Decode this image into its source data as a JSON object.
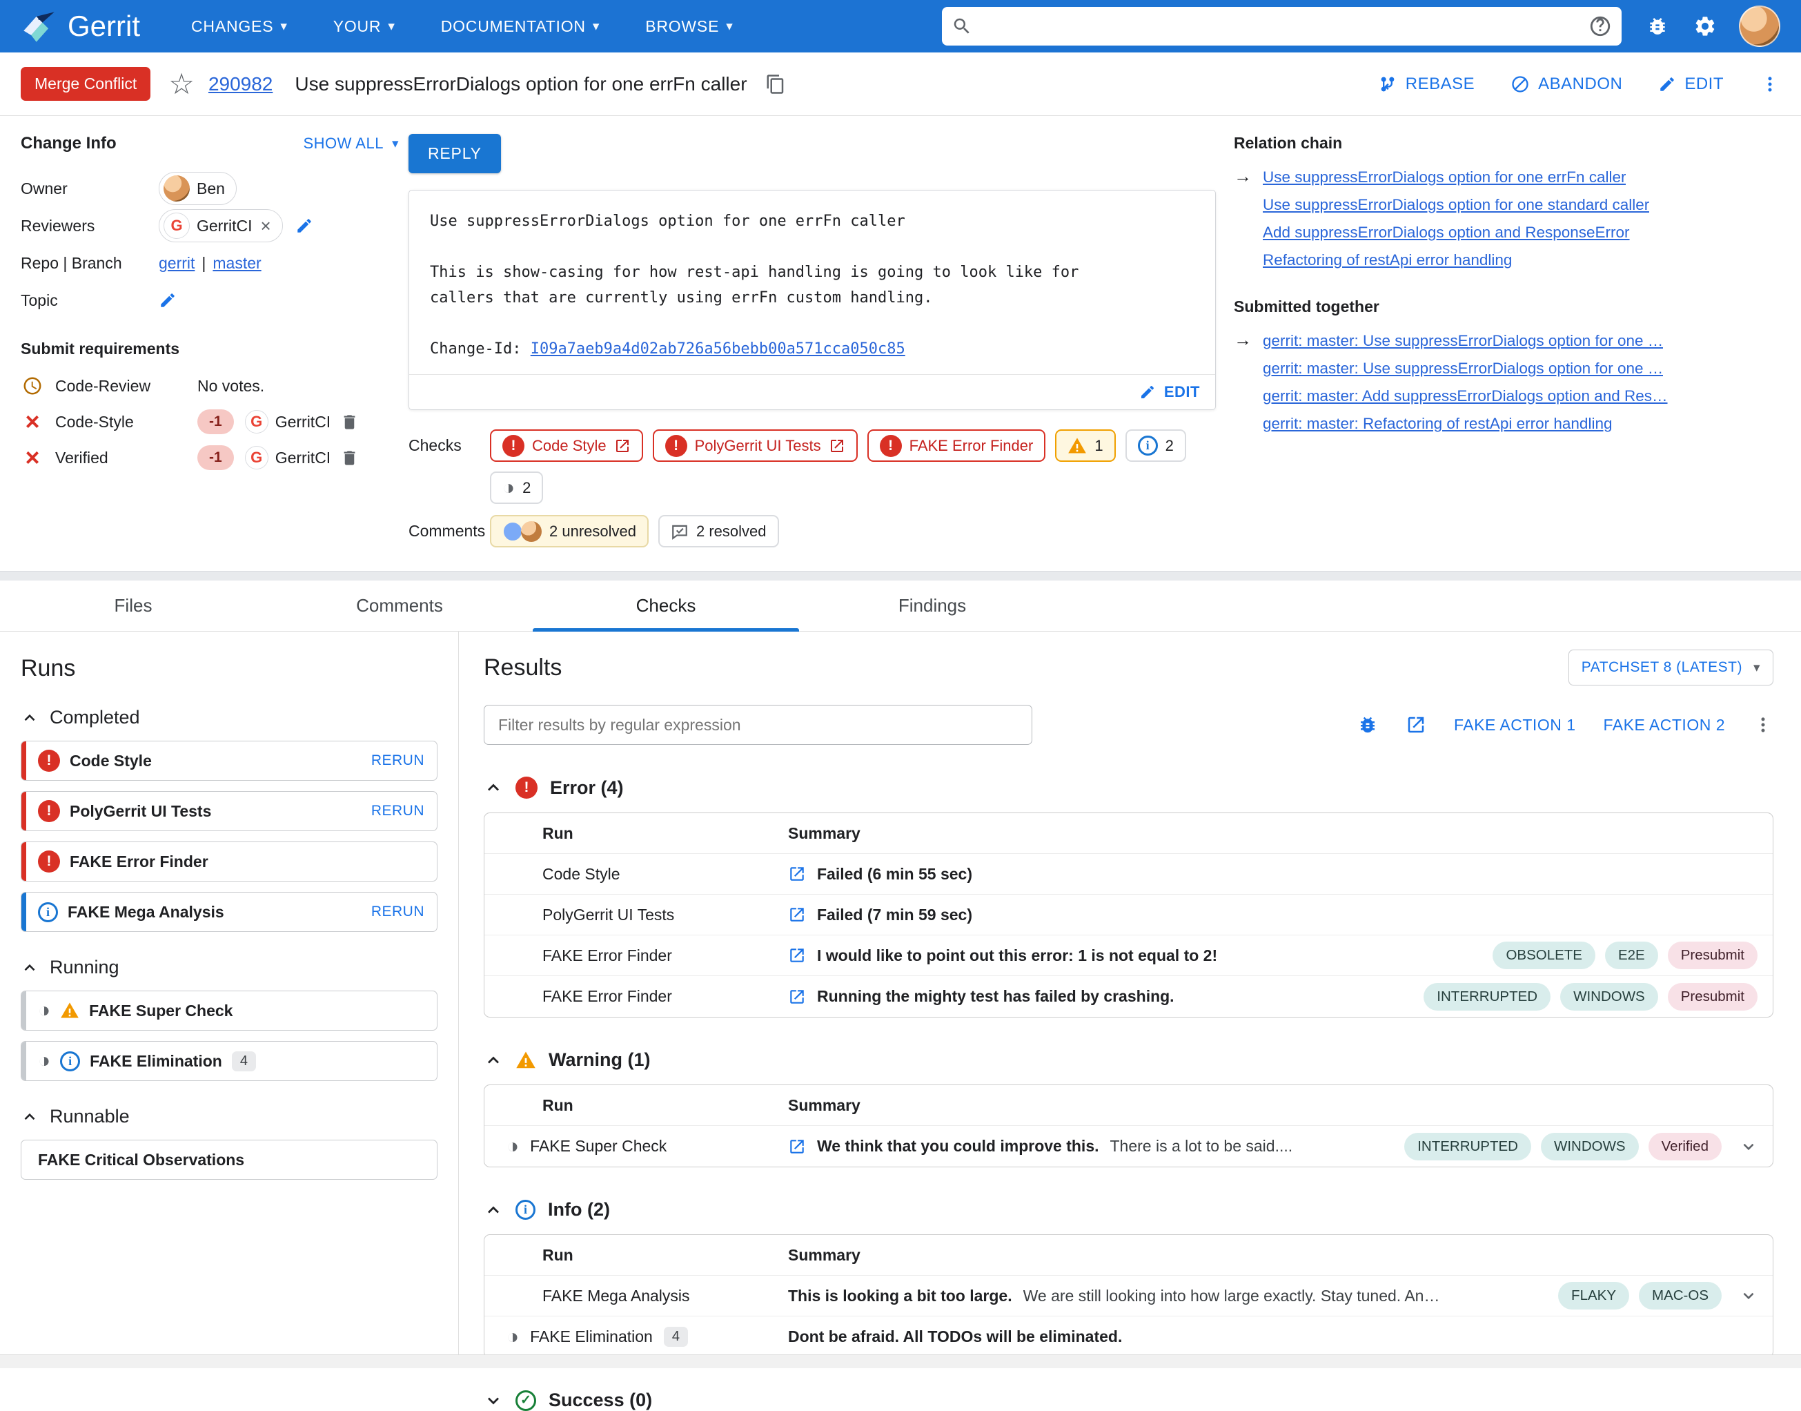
{
  "colors": {
    "topbar_blue": "#1c73d3",
    "accent_blue": "#1976d2",
    "action_blue": "#1a73e8",
    "link_blue": "#2a66d9",
    "error_red": "#d93025",
    "warning_orange": "#f29900",
    "success_green": "#188038"
  },
  "topbar": {
    "brand": "Gerrit",
    "nav": [
      {
        "label": "CHANGES"
      },
      {
        "label": "YOUR"
      },
      {
        "label": "DOCUMENTATION"
      },
      {
        "label": "BROWSE"
      }
    ],
    "search": {
      "value": "",
      "placeholder": ""
    }
  },
  "header": {
    "status": "Merge Conflict",
    "change_number": "290982",
    "title": "Use suppressErrorDialogs option for one errFn caller",
    "rebase": "REBASE",
    "abandon": "ABANDON",
    "edit": "EDIT"
  },
  "change_info": {
    "heading": "Change Info",
    "show_all": "SHOW ALL",
    "owner_label": "Owner",
    "owner_name": "Ben",
    "reviewers_label": "Reviewers",
    "reviewer_name": "GerritCI",
    "reviewer_initial": "G",
    "repo_branch_label": "Repo | Branch",
    "repo": "gerrit",
    "separator": "|",
    "branch": "master",
    "topic_label": "Topic",
    "submit_requirements_heading": "Submit requirements",
    "code_review_label": "Code-Review",
    "code_review_value": "No votes.",
    "code_style_label": "Code-Style",
    "code_style_vote": "-1",
    "code_style_by": "GerritCI",
    "verified_label": "Verified",
    "verified_vote": "-1",
    "verified_by": "GerritCI"
  },
  "reply_button": "REPLY",
  "commit_message": {
    "title_line": "Use suppressErrorDialogs option for one errFn caller",
    "body_line1": "This is show-casing for how rest-api handling is going to look like for",
    "body_line2": "callers that are currently using errFn custom handling.",
    "change_id_label": "Change-Id: ",
    "change_id": "I09a7aeb9a4d02ab726a56bebb00a571cca050c85",
    "edit_link": "EDIT"
  },
  "checks_summary": {
    "label": "Checks",
    "chips": [
      {
        "label": "Code Style",
        "status": "error"
      },
      {
        "label": "PolyGerrit UI Tests",
        "status": "error"
      },
      {
        "label": "FAKE Error Finder",
        "status": "error"
      }
    ],
    "warning_count": "1",
    "info_count": "2",
    "running_count": "2"
  },
  "comments_summary": {
    "label": "Comments",
    "unresolved": "2 unresolved",
    "resolved": "2 resolved"
  },
  "relation_chain": {
    "heading": "Relation chain",
    "items": [
      {
        "label": "Use suppressErrorDialogs option for one errFn caller"
      },
      {
        "label": "Use suppressErrorDialogs option for one standard caller"
      },
      {
        "label": "Add suppressErrorDialogs option and ResponseError"
      },
      {
        "label": "Refactoring of restApi error handling"
      }
    ]
  },
  "submitted_together": {
    "heading": "Submitted together",
    "items": [
      {
        "label": "gerrit: master: Use suppressErrorDialogs option for one …"
      },
      {
        "label": "gerrit: master: Use suppressErrorDialogs option for one …"
      },
      {
        "label": "gerrit: master: Add suppressErrorDialogs option and Res…"
      },
      {
        "label": "gerrit: master: Refactoring of restApi error handling"
      }
    ]
  },
  "tabs": [
    {
      "label": "Files"
    },
    {
      "label": "Comments"
    },
    {
      "label": "Checks",
      "active": true
    },
    {
      "label": "Findings"
    }
  ],
  "runs_panel": {
    "heading": "Runs",
    "sections": [
      {
        "title": "Completed",
        "runs": [
          {
            "label": "Code Style",
            "status": "error",
            "action": "RERUN"
          },
          {
            "label": "PolyGerrit UI Tests",
            "status": "error",
            "action": "RERUN"
          },
          {
            "label": "FAKE Error Finder",
            "status": "error"
          },
          {
            "label": "FAKE Mega Analysis",
            "status": "info",
            "action": "RERUN"
          }
        ]
      },
      {
        "title": "Running",
        "runs": [
          {
            "label": "FAKE Super Check",
            "status": "running-warning"
          },
          {
            "label": "FAKE Elimination",
            "status": "running-info",
            "badge": "4"
          }
        ]
      },
      {
        "title": "Runnable",
        "runs": [
          {
            "label": "FAKE Critical Observations"
          }
        ]
      }
    ]
  },
  "results_panel": {
    "heading": "Results",
    "patchset_button": "PATCHSET 8 (LATEST)",
    "filter_placeholder": "Filter results by regular expression",
    "action1": "FAKE ACTION 1",
    "action2": "FAKE ACTION 2",
    "table_header_run": "Run",
    "table_header_summary": "Summary",
    "sections": {
      "error": {
        "title": "Error (4)",
        "rows": [
          {
            "run": "Code Style",
            "summary": "Failed (6 min 55 sec)"
          },
          {
            "run": "PolyGerrit UI Tests",
            "summary": "Failed (7 min 59 sec)"
          },
          {
            "run": "FAKE Error Finder",
            "summary": "I would like to point out this error: 1 is not equal to 2!",
            "tags": [
              {
                "label": "OBSOLETE",
                "style": "cyan"
              },
              {
                "label": "E2E",
                "style": "cyan"
              },
              {
                "label": "Presubmit",
                "style": "pink"
              }
            ]
          },
          {
            "run": "FAKE Error Finder",
            "summary": "Running the mighty test has failed by crashing.",
            "tags": [
              {
                "label": "INTERRUPTED",
                "style": "cyan"
              },
              {
                "label": "WINDOWS",
                "style": "cyan"
              },
              {
                "label": "Presubmit",
                "style": "pink"
              }
            ]
          }
        ]
      },
      "warning": {
        "title": "Warning (1)",
        "rows": [
          {
            "run": "FAKE Super Check",
            "running": true,
            "summary": "We think that you could improve this.",
            "detail": "There is a lot to be said....",
            "tags": [
              {
                "label": "INTERRUPTED",
                "style": "cyan"
              },
              {
                "label": "WINDOWS",
                "style": "cyan"
              },
              {
                "label": "Verified",
                "style": "pink"
              }
            ]
          }
        ]
      },
      "info": {
        "title": "Info (2)",
        "rows": [
          {
            "run": "FAKE Mega Analysis",
            "summary": "This is looking a bit too large.",
            "detail": "We are still looking into how large exactly. Stay tuned. An…",
            "tags": [
              {
                "label": "FLAKY",
                "style": "cyan"
              },
              {
                "label": "MAC-OS",
                "style": "cyan"
              }
            ]
          },
          {
            "run": "FAKE Elimination",
            "running": true,
            "badge": "4",
            "summary": "Dont be afraid. All TODOs will be eliminated."
          }
        ]
      },
      "success": {
        "title": "Success (0)"
      }
    }
  }
}
